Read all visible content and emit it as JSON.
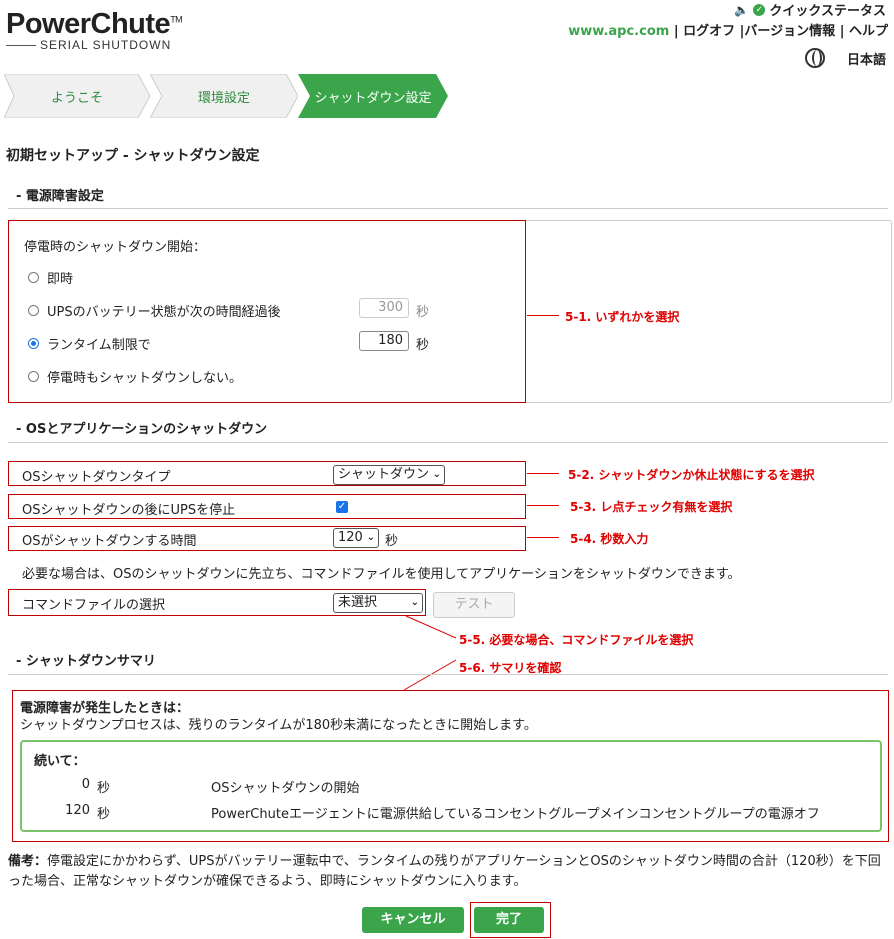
{
  "header": {
    "logo": "PowerChute",
    "logo_tm": "TM",
    "logo_sub": "SERIAL SHUTDOWN",
    "quick_status": "クイックステータス",
    "link_apc": "www.apc.com",
    "link_logoff": "ログオフ",
    "link_version": "バージョン情報",
    "link_help": "ヘルプ",
    "language": "日本語"
  },
  "steps": [
    {
      "label": "ようこそ",
      "active": false
    },
    {
      "label": "環境設定",
      "active": false
    },
    {
      "label": "シャットダウン設定",
      "active": true
    }
  ],
  "page_title": "初期セットアップ - シャットダウン設定",
  "power_fail": {
    "heading": "- 電源障害設定",
    "start_label": "停電時のシャットダウン開始：",
    "options": [
      {
        "label": "即時",
        "selected": false
      },
      {
        "label": "UPSのバッテリー状態が次の時間経過後",
        "selected": false,
        "value": "300",
        "unit": "秒"
      },
      {
        "label": "ランタイム制限で",
        "selected": true,
        "value": "180",
        "unit": "秒"
      },
      {
        "label": "停電時もシャットダウンしない。",
        "selected": false
      }
    ]
  },
  "os_shutdown": {
    "heading": "- OSとアプリケーションのシャットダウン",
    "type_label": "OSシャットダウンタイプ",
    "type_value": "シャットダウン",
    "stop_ups_label": "OSシャットダウンの後にUPSを停止",
    "stop_ups_checked": true,
    "time_label": "OSがシャットダウンする時間",
    "time_value": "120",
    "time_unit": "秒",
    "note": "必要な場合は、OSのシャットダウンに先立ち、コマンドファイルを使用してアプリケーションをシャットダウンできます。",
    "cmd_label": "コマンドファイルの選択",
    "cmd_value": "未選択",
    "test_button": "テスト"
  },
  "summary": {
    "heading": "- シャットダウンサマリ",
    "when_label": "電源障害が発生したときは：",
    "when_text": "シャットダウンプロセスは、残りのランタイムが180秒未満になったときに開始します。",
    "then_label": "続いて：",
    "rows": [
      {
        "time": "0",
        "unit": "秒",
        "event": "OSシャットダウンの開始"
      },
      {
        "time": "120",
        "unit": "秒",
        "event": "PowerChuteエージェントに電源供給しているコンセントグループメインコンセントグループの電源オフ"
      }
    ],
    "remark_label": "備考：",
    "remark_text": "停電設定にかかわらず、UPSがバッテリー運転中で、ランタイムの残りがアプリケーションとOSのシャットダウン時間の合計（120秒）を下回った場合、正常なシャットダウンが確保できるよう、即時にシャットダウンに入ります。"
  },
  "buttons": {
    "cancel": "キャンセル",
    "finish": "完了"
  },
  "annotations": {
    "a1": "5-1. いずれかを選択",
    "a2": "5-2. シャットダウンか休止状態にするを選択",
    "a3": "5-3. レ点チェック有無を選択",
    "a4": "5-4. 秒数入力",
    "a5": "5-5. 必要な場合、コマンドファイルを選択",
    "a6": "5-6. サマリを確認"
  },
  "colors": {
    "brand_green": "#3aa54a",
    "annotation_red": "#e00000"
  }
}
